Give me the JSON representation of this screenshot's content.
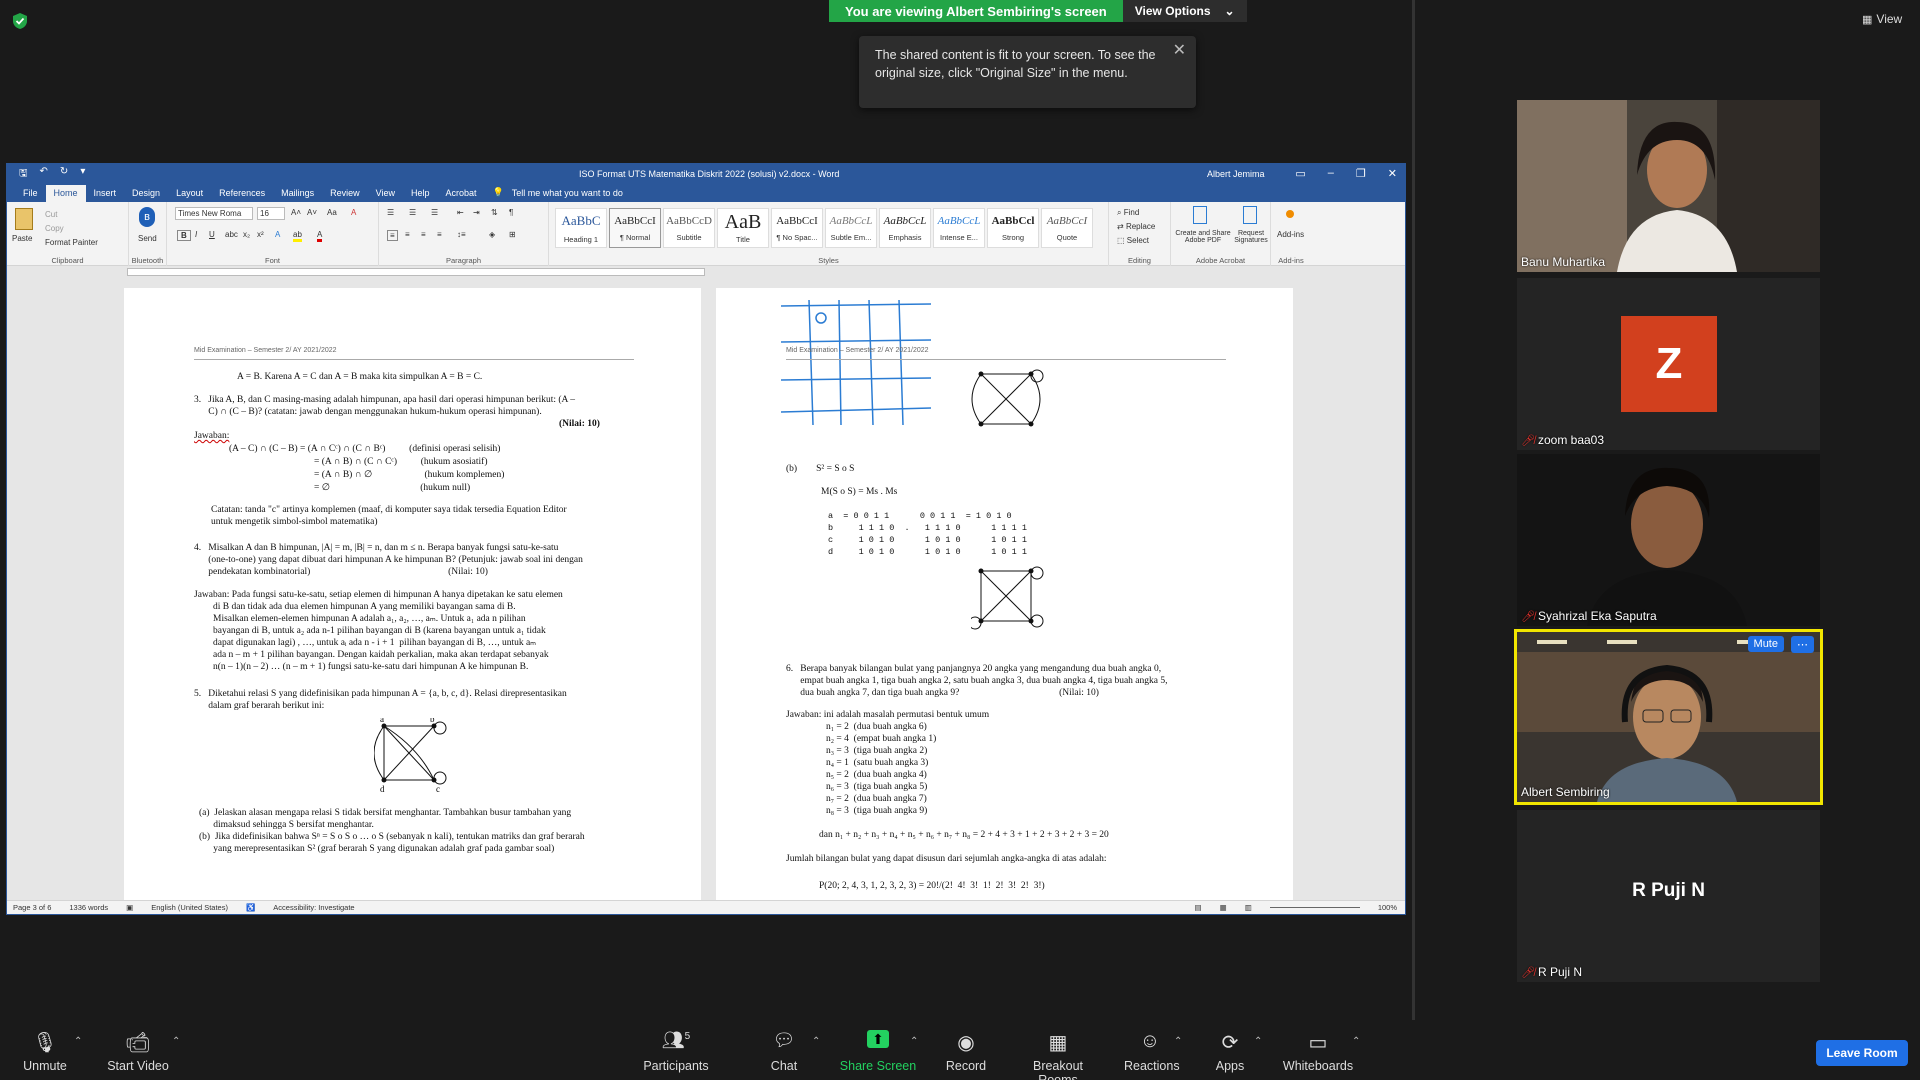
{
  "banner": {
    "viewing": "You are viewing Albert Sembiring's screen",
    "view_options": "View Options"
  },
  "tooltip": {
    "text": "The shared content is fit to your screen. To see the original size, click \"Original Size\" in the menu."
  },
  "top_right": {
    "view_label": "View"
  },
  "word": {
    "doc_title": "ISO Format UTS Matematika Diskrit 2022 (solusi) v2.docx  -  Word",
    "user": "Albert Jemima",
    "tabs": [
      "File",
      "Home",
      "Insert",
      "Design",
      "Layout",
      "References",
      "Mailings",
      "Review",
      "View",
      "Help",
      "Acrobat"
    ],
    "tell_me": "Tell me what you want to do",
    "clipboard": {
      "paste": "Paste",
      "cut": "Cut",
      "copy": "Copy",
      "format_painter": "Format Painter",
      "label": "Clipboard"
    },
    "bluetooth": {
      "send": "Send",
      "label": "Bluetooth"
    },
    "font": {
      "name": "Times New Roma",
      "size": "16",
      "label": "Font"
    },
    "paragraph_label": "Paragraph",
    "styles": [
      {
        "preview": "AaBbC",
        "name": "Heading 1"
      },
      {
        "preview": "AaBbCcI",
        "name": "¶ Normal"
      },
      {
        "preview": "AaBbCcD",
        "name": "Subtitle"
      },
      {
        "preview": "AaB",
        "name": "Title"
      },
      {
        "preview": "AaBbCcI",
        "name": "¶ No Spac..."
      },
      {
        "preview": "AaBbCcL",
        "name": "Subtle Em..."
      },
      {
        "preview": "AaBbCcL",
        "name": "Emphasis"
      },
      {
        "preview": "AaBbCcL",
        "name": "Intense E..."
      },
      {
        "preview": "AaBbCcl",
        "name": "Strong"
      },
      {
        "preview": "AaBbCcI",
        "name": "Quote"
      }
    ],
    "styles_label": "Styles",
    "editing": {
      "find": "Find",
      "replace": "Replace",
      "select": "Select",
      "label": "Editing"
    },
    "acrobat": {
      "create": "Create and Share Adobe PDF",
      "request": "Request Signatures",
      "label": "Adobe Acrobat"
    },
    "addins": {
      "btn": "Add-ins",
      "label": "Add-ins"
    },
    "status": {
      "page": "Page 3 of 6",
      "words": "1336 words",
      "lang": "English (United States)",
      "access": "Accessibility: Investigate",
      "zoom": "100%"
    },
    "page_header_left": "Mid Examination – Semester 2/ AY 2021/2022",
    "left_page": [
      "A = B. Karena A = C dan A = B maka kita simpulkan A = B = C.",
      "3.   Jika A, B, dan C masing-masing adalah himpunan, apa hasil dari operasi himpunan berikut: (A –",
      "      C) ∩ (C – B)? (catatan: jawab dengan menggunakan hukum-hukum operasi himpunan).",
      "(Nilai: 10)",
      "Jawaban:",
      "(A – C) ∩ (C – B) = (A ∩ Cᶜ) ∩ (C ∩ Bᶜ)          (definisi operasi selisih)",
      "= (A ∩ B) ∩ (C ∩ Cᶜ)          (hukum asosiatif)",
      "= (A ∩ B) ∩ ∅                      (hukum komplemen)",
      "= ∅                                      (hukum null)",
      "Catatan: tanda \"c\" artinya komplemen (maaf, di komputer saya tidak tersedia Equation Editor",
      "untuk mengetik simbol-simbol matematika)",
      "4.   Misalkan A dan B himpunan, |A| = m, |B| = n, dan m ≤ n. Berapa banyak fungsi satu-ke-satu",
      "      (one-to-one) yang dapat dibuat dari himpunan A ke himpunan B? (Petunjuk: jawab soal ini dengan",
      "      pendekatan kombinatorial)                                                          (Nilai: 10)",
      "Jawaban: Pada fungsi satu-ke-satu, setiap elemen di himpunan A hanya dipetakan ke satu elemen",
      "        di B dan tidak ada dua elemen himpunan A yang memiliki bayangan sama di B.",
      "        Misalkan elemen-elemen himpunan A adalah a₁, a₂, …, aₘ. Untuk a₁ ada n pilihan",
      "        bayangan di B, untuk a₂ ada n-1 pilihan bayangan di B (karena bayangan untuk a₁ tidak",
      "        dapat digunakan lagi) , …, untuk aᵢ ada n - i + 1  pilihan bayangan di B, …, untuk aₘ",
      "        ada n – m + 1 pilihan bayangan. Dengan kaidah perkalian, maka akan terdapat sebanyak",
      "        n(n – 1)(n – 2) … (n – m + 1) fungsi satu-ke-satu dari himpunan A ke himpunan B.",
      "5.   Diketahui relasi S yang didefinisikan pada himpunan A = {a, b, c, d}. Relasi direpresentasikan",
      "      dalam graf berarah berikut ini:",
      "(a)  Jelaskan alasan mengapa relasi S tidak bersifat menghantar. Tambahkan busur tambahan yang",
      "      dimaksud sehingga S bersifat menghantar.",
      "(b)  Jika didefinisikan bahwa Sⁿ = S o S o … o S (sebanyak n kali), tentukan matriks dan graf berarah",
      "      yang merepresentasikan S² (graf berarah S yang digunakan adalah graf pada gambar soal)"
    ],
    "right_page": [
      "(b)        S² = S o S",
      "M(S o S) = Ms . Ms",
      "a  = 0 0 1 1      0 0 1 1  = 1 0 1 0",
      "b     1 1 1 0  .   1 1 1 0      1 1 1 1",
      "c     1 0 1 0      1 0 1 0      1 0 1 1",
      "d     1 0 1 0      1 0 1 0      1 0 1 1",
      "6.   Berapa banyak bilangan bulat yang panjangnya 20 angka yang mengandung dua buah angka 0,",
      "      empat buah angka 1, tiga buah angka 2, satu buah angka 3, dua buah angka 4, tiga buah angka 5,",
      "      dua buah angka 7, dan tiga buah angka 9?                                          (Nilai: 10)",
      "Jawaban: ini adalah masalah permutasi bentuk umum",
      "n₁ = 2  (dua buah angka 6)",
      "n₂ = 4  (empat buah angka 1)",
      "n₃ = 3  (tiga buah angka 2)",
      "n₄ = 1  (satu buah angka 3)",
      "n₅ = 2  (dua buah angka 4)",
      "n₆ = 3  (tiga buah angka 5)",
      "n₇ = 2  (dua buah angka 7)",
      "n₈ = 3  (tiga buah angka 9)",
      "dan n₁ + n₂ + n₃ + n₄ + n₅ + n₆ + n₇ + n₈ = 2 + 4 + 3 + 1 + 2 + 3 + 2 + 3 = 20",
      "Jumlah bilangan bulat yang dapat disusun dari sejumlah angka-angka di atas adalah:",
      "P(20; 2, 4, 3, 1, 2, 3, 2, 3) = 20!/(2!  4!  3!  1!  2!  3!  2!  3!)"
    ],
    "graph_nodes": [
      "a",
      "b",
      "c",
      "d"
    ]
  },
  "participants": [
    {
      "name": "Banu Muhartika",
      "muted": false
    },
    {
      "name": "zoom baa03",
      "muted": true,
      "initial": "Z"
    },
    {
      "name": "Syahrizal Eka Saputra",
      "muted": true
    },
    {
      "name": "Albert Sembiring",
      "muted": false,
      "mute_btn": "Mute"
    },
    {
      "name": "R Puji N",
      "muted": true
    }
  ],
  "toolbar": {
    "unmute": "Unmute",
    "start_video": "Start Video",
    "participants": "Participants",
    "participants_count": "5",
    "chat": "Chat",
    "share": "Share Screen",
    "record": "Record",
    "breakout": "Breakout Rooms",
    "reactions": "Reactions",
    "apps": "Apps",
    "whiteboards": "Whiteboards",
    "leave": "Leave Room"
  },
  "colors": {
    "zoom_green": "#23a547",
    "word_blue": "#2b579a",
    "leave_blue": "#1f6fe5",
    "active_speaker": "#f2e600",
    "avatar_orange": "#d2401e"
  }
}
